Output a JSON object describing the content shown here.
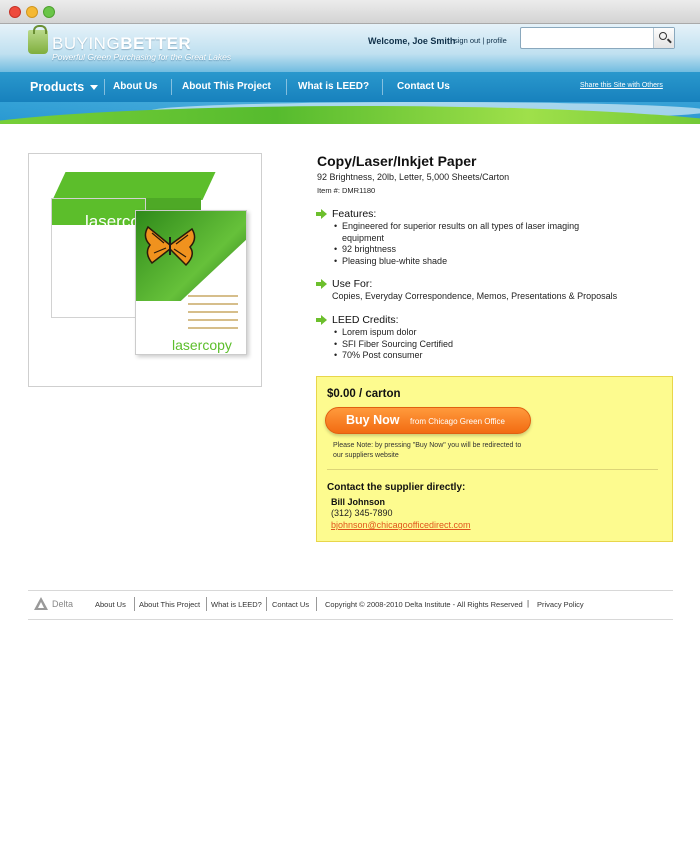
{
  "header": {
    "logo_bold": "BUYING",
    "logo_rest": "BETTER",
    "tagline": "Powerful Green Purchasing for the Great Lakes",
    "welcome": "Welcome, Joe Smith",
    "sign_out": "sign out",
    "separator": "|",
    "profile": "profile",
    "search_placeholder": ""
  },
  "nav": {
    "products": "Products",
    "about_us": "About Us",
    "about_project": "About This Project",
    "what_is_leed": "What is LEED?",
    "contact_us": "Contact Us",
    "share": "Share this Site with Others"
  },
  "product": {
    "title": "Copy/Laser/Inkjet Paper",
    "subtitle": "92 Brightness, 20lb, Letter, 5,000 Sheets/Carton",
    "item_number": "Item #: DMR1180",
    "image_brand": "lasercopy",
    "features_heading": "Features:",
    "features": [
      "Engineered for superior results on all types of laser imaging equipment",
      "92 brightness",
      "Pleasing blue-white shade"
    ],
    "use_for_heading": "Use For:",
    "use_for": "Copies, Everyday Correspondence, Memos, Presentations & Proposals",
    "leed_heading": "LEED Credits:",
    "leed_credits": [
      "Lorem ispum dolor",
      "SFI Fiber Sourcing Certified",
      "70% Post consumer"
    ]
  },
  "buy": {
    "price": "$0.00 / carton",
    "button_label": "Buy Now",
    "button_sub": "from Chicago Green Office",
    "note": "Please Note: by pressing \"Buy Now\" you will be redirected to our suppliers website",
    "contact_heading": "Contact the supplier directly:",
    "contact_name": "Bill Johnson",
    "contact_phone": "(312) 345-7890",
    "contact_email": "bjohnson@chicagoofficedirect.com"
  },
  "footer": {
    "brand": "Delta",
    "links": [
      "About Us",
      "About This Project",
      "What is LEED?",
      "Contact Us"
    ],
    "copyright": "Copyright © 2008-2010 Delta Institute - All Rights Reserved",
    "pipe": "|",
    "privacy": "Privacy Policy"
  },
  "colors": {
    "nav_blue": "#1f8ac6",
    "accent_green": "#6cbf2c",
    "buy_orange": "#f26b12",
    "buybox_yellow": "#fdfb8f"
  }
}
